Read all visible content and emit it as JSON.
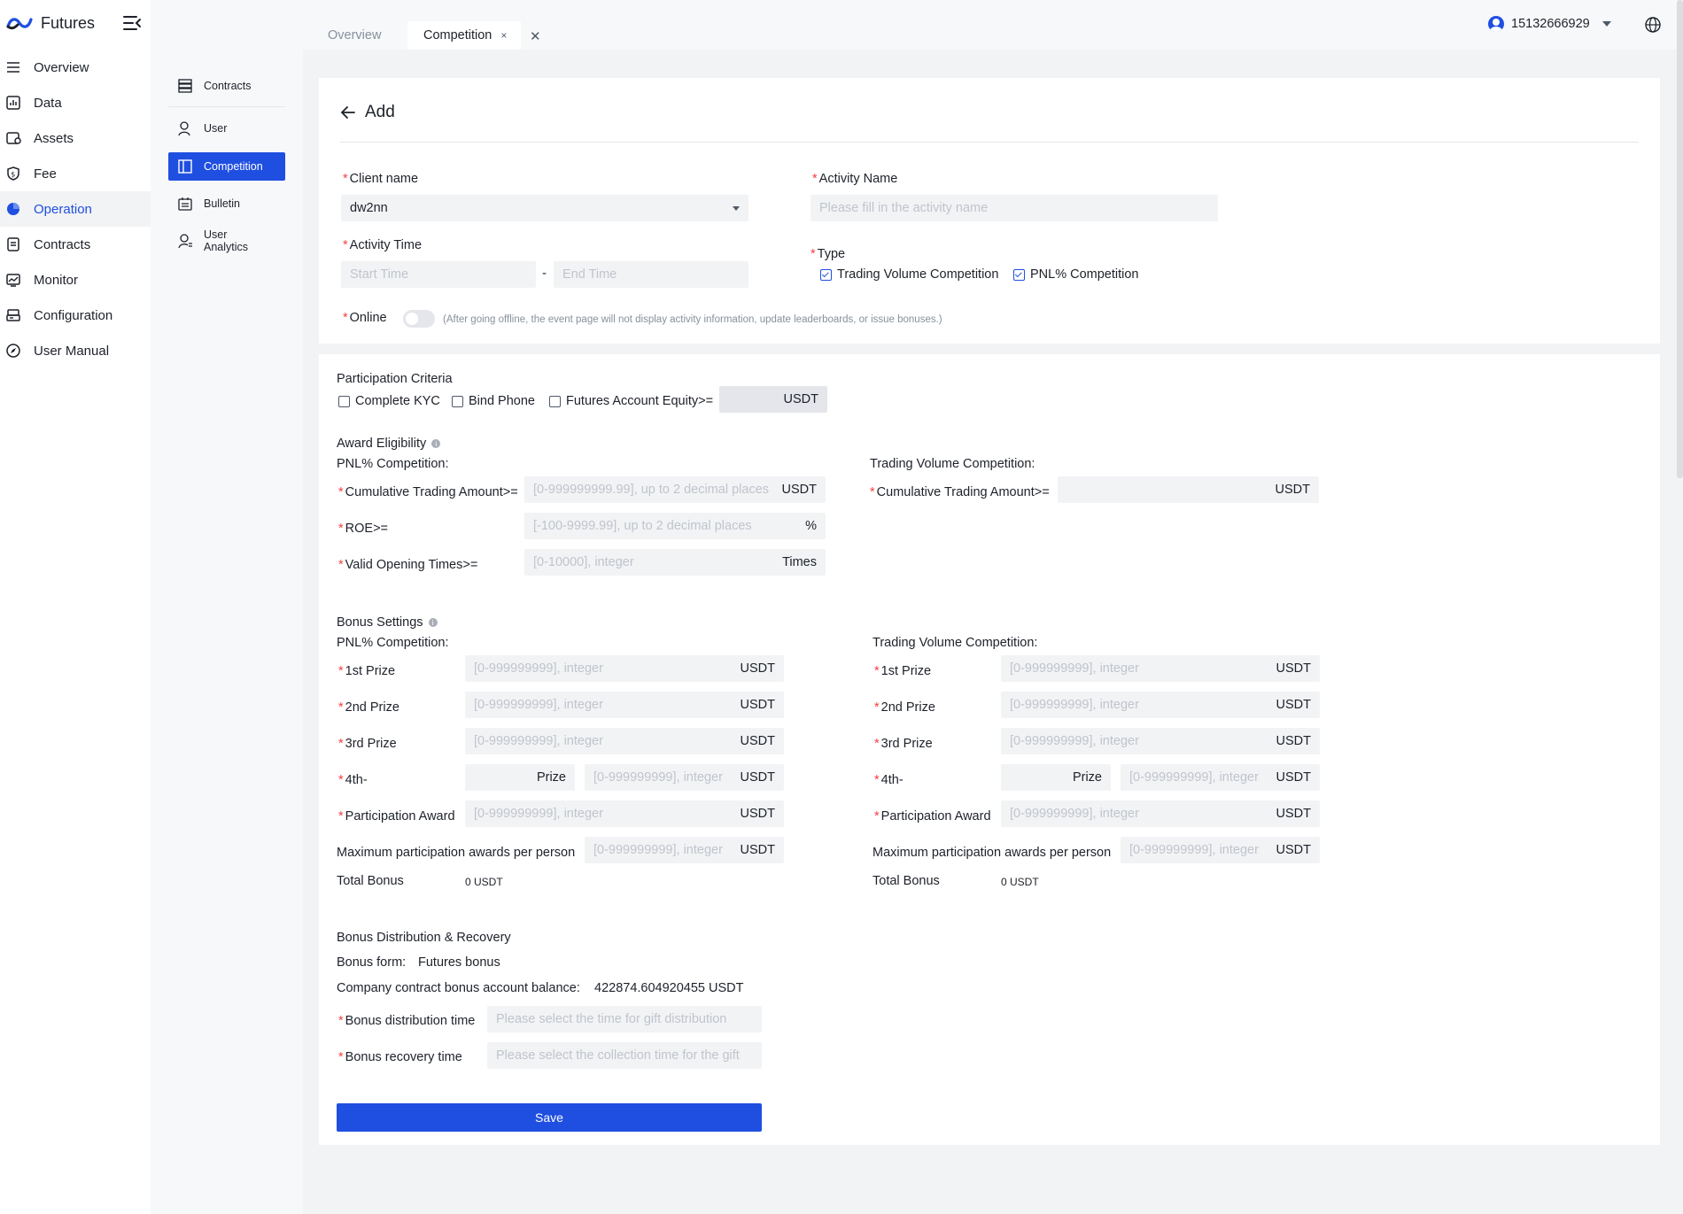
{
  "app": {
    "title": "Futures"
  },
  "nav": [
    {
      "label": "Overview",
      "icon": "list-icon"
    },
    {
      "label": "Data",
      "icon": "bar-chart-icon"
    },
    {
      "label": "Assets",
      "icon": "wallet-icon"
    },
    {
      "label": "Fee",
      "icon": "shield-dollar-icon"
    },
    {
      "label": "Operation",
      "icon": "pie-chart-icon",
      "active": true
    },
    {
      "label": "Contracts",
      "icon": "document-icon"
    },
    {
      "label": "Monitor",
      "icon": "monitor-icon"
    },
    {
      "label": "Configuration",
      "icon": "config-icon"
    },
    {
      "label": "User Manual",
      "icon": "compass-icon"
    }
  ],
  "submenu": [
    {
      "label": "Contracts"
    },
    {
      "label": "User"
    },
    {
      "label": "Competition",
      "active": true
    },
    {
      "label": "Bulletin"
    },
    {
      "label": "User Analytics"
    }
  ],
  "tabs": {
    "overview": "Overview",
    "competition": "Competition",
    "close": "×",
    "close_all": "✕"
  },
  "user": {
    "id": "15132666929"
  },
  "page": {
    "title": "Add"
  },
  "form": {
    "client_name_label": "Client name",
    "client_name_value": "dw2nn",
    "activity_name_label": "Activity Name",
    "activity_name_placeholder": "Please fill in the activity name",
    "activity_time_label": "Activity Time",
    "start_time_placeholder": "Start Time",
    "end_time_placeholder": "End Time",
    "time_separator": "-",
    "type_label": "Type",
    "type_trading_volume": "Trading Volume Competition",
    "type_pnl": "PNL% Competition",
    "online_label": "Online",
    "online_hint": "(After going offline, the event page will not display activity information, update leaderboards, or issue bonuses.)"
  },
  "criteria": {
    "title": "Participation Criteria",
    "kyc": "Complete KYC",
    "bind_phone": "Bind Phone",
    "equity": "Futures Account Equity>=",
    "equity_unit": "USDT"
  },
  "eligibility": {
    "title": "Award Eligibility",
    "pnl_title": "PNL% Competition:",
    "volume_title": "Trading Volume Competition:",
    "cum_label": "Cumulative Trading Amount>=",
    "cum_placeholder": "[0-999999999.99], up to 2 decimal places",
    "cum_unit": "USDT",
    "roe_label": "ROE>=",
    "roe_placeholder": "[-100-9999.99], up to 2 decimal places",
    "roe_unit": "%",
    "opening_label": "Valid Opening Times>=",
    "opening_placeholder": "[0-10000], integer",
    "opening_unit": "Times"
  },
  "bonus": {
    "title": "Bonus Settings",
    "pnl_title": "PNL% Competition:",
    "volume_title": "Trading Volume Competition:",
    "prize1": "1st Prize",
    "prize2": "2nd Prize",
    "prize3": "3rd Prize",
    "prize4": "4th-",
    "prize4_unit": "Prize",
    "participation": "Participation Award",
    "max_participation": "Maximum participation awards per person",
    "total": "Total Bonus",
    "total_value": "0 USDT",
    "placeholder": "[0-999999999], integer",
    "unit": "USDT"
  },
  "distribution": {
    "title": "Bonus Distribution & Recovery",
    "form_label": "Bonus form:",
    "form_value": "Futures bonus",
    "balance_label": "Company contract bonus account balance:",
    "balance_value": "422874.604920455 USDT",
    "dist_time_label": "Bonus distribution time",
    "dist_time_placeholder": "Please select the time for gift distribution",
    "recovery_time_label": "Bonus recovery time",
    "recovery_time_placeholder": "Please select the collection time for the gift"
  },
  "actions": {
    "save": "Save"
  },
  "colors": {
    "accent": "#1f4fe0",
    "required": "#f53f3f"
  }
}
